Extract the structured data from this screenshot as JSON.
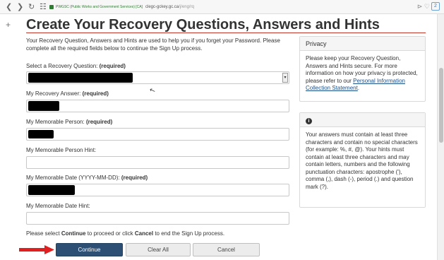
{
  "browser": {
    "site_name": "PWGSC (Public Works and Government Services) [CA]",
    "url_host": "clegc-gckey.gc.ca",
    "url_path": "/j/eng/rq",
    "ext_badge": "2"
  },
  "page": {
    "title": "Create Your Recovery Questions, Answers and Hints",
    "intro": "Your Recovery Question, Answers and Hints are used to help you if you forget your Password. Please complete all the required fields below to continue the Sign Up process.",
    "required_tag": "(required)",
    "fields": {
      "question_label": "Select a Recovery Question:",
      "answer_label": "My Recovery Answer:",
      "person_label": "My Memorable Person:",
      "person_hint_label": "My Memorable Person Hint:",
      "date_label": "My Memorable Date (YYYY-MM-DD):",
      "date_hint_label": "My Memorable Date Hint:"
    },
    "footer_pre": "Please select ",
    "footer_continue": "Continue",
    "footer_mid": " to proceed or click ",
    "footer_cancel": "Cancel",
    "footer_post": " to end the Sign Up process."
  },
  "buttons": {
    "continue": "Continue",
    "clear": "Clear All",
    "cancel": "Cancel"
  },
  "privacy_panel": {
    "heading": "Privacy",
    "text": "Please keep your Recovery Question, Answers and Hints secure. For more information on how your privacy is protected, please refer to our ",
    "link": "Personal Information Collection Statement",
    "text_end": "."
  },
  "info_panel": {
    "icon": "info-icon",
    "text": "Your answers must contain at least three characters and contain no special characters (for example: %, #, @). Your hints must contain at least three characters and may contain letters, numbers and the following punctuation characters: apostrophe ('), comma (,), dash (-), period (.) and question mark (?)."
  },
  "colors": {
    "accent_rule": "#c0392b",
    "primary_button": "#2c4f73",
    "annotation_arrow": "#e02020"
  }
}
